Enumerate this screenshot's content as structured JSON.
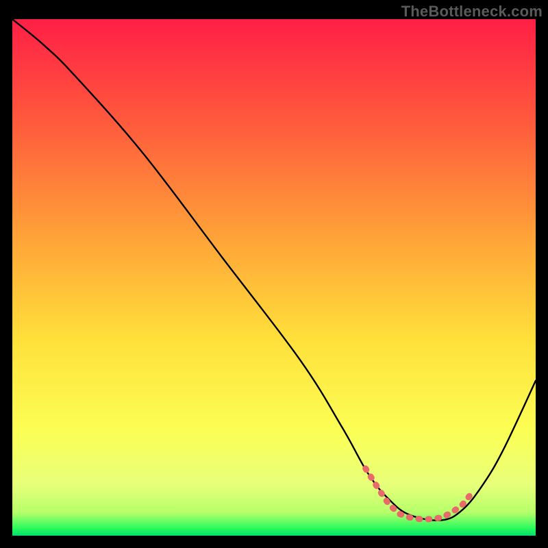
{
  "watermark": "TheBottleneck.com",
  "chart_data": {
    "type": "line",
    "title": "",
    "xlabel": "",
    "ylabel": "",
    "xlim": [
      0,
      100
    ],
    "ylim": [
      0,
      100
    ],
    "series": [
      {
        "name": "curve",
        "x": [
          0,
          6,
          12,
          25,
          40,
          55,
          63,
          68,
          72,
          76,
          82,
          86,
          90,
          94,
          100
        ],
        "values": [
          100,
          95,
          89,
          74,
          54,
          34,
          21,
          12,
          7,
          4,
          3,
          5,
          10,
          17,
          30
        ]
      }
    ],
    "highlight": {
      "name": "optimal-zone",
      "x": [
        67.5,
        70,
        72,
        74,
        76,
        78,
        80,
        82,
        84,
        86,
        88
      ],
      "values": [
        13,
        9,
        6,
        4.2,
        3.5,
        3.2,
        3.2,
        3.5,
        4.5,
        6,
        8.5
      ]
    },
    "gradient_stops": [
      {
        "offset": 0.0,
        "color": "#ff1f46"
      },
      {
        "offset": 0.2,
        "color": "#ff5a3c"
      },
      {
        "offset": 0.42,
        "color": "#ffa238"
      },
      {
        "offset": 0.62,
        "color": "#ffe03a"
      },
      {
        "offset": 0.8,
        "color": "#fbff55"
      },
      {
        "offset": 0.9,
        "color": "#e8ff7a"
      },
      {
        "offset": 0.955,
        "color": "#b6ff6a"
      },
      {
        "offset": 0.985,
        "color": "#2dfb5d"
      },
      {
        "offset": 1.0,
        "color": "#00e06a"
      }
    ],
    "colors": {
      "curve": "#000000",
      "highlight": "#e86a6a",
      "frame": "#000000"
    }
  }
}
